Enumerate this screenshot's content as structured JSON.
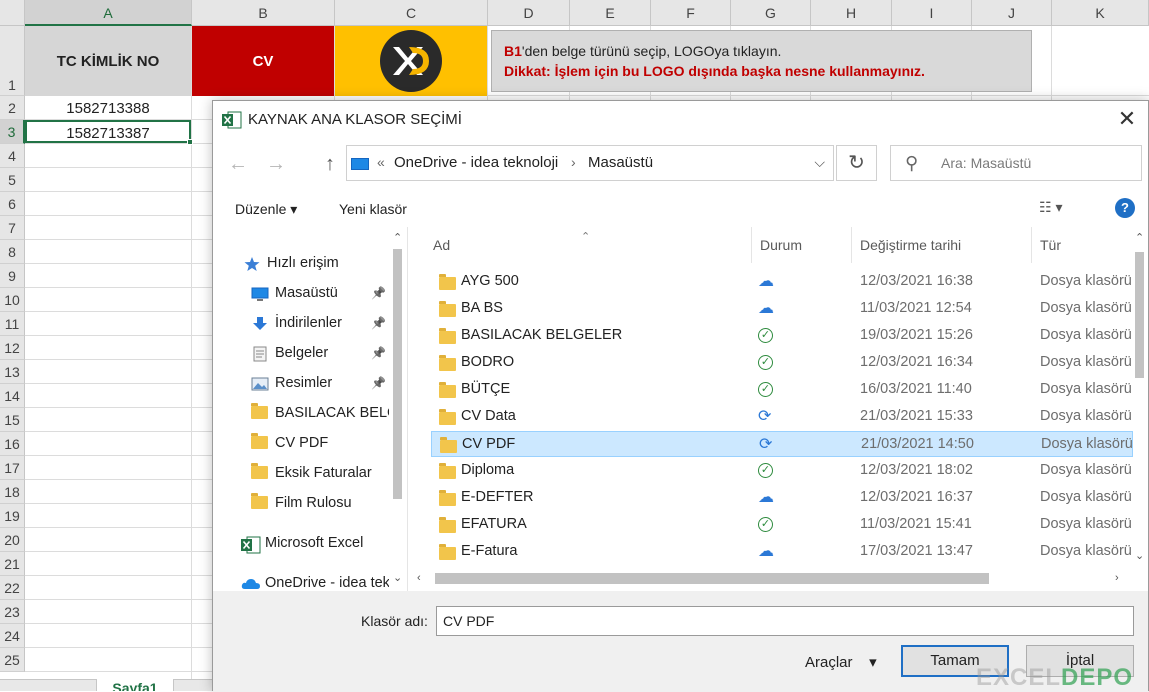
{
  "sheet": {
    "columns": [
      "A",
      "B",
      "C",
      "D",
      "E",
      "F",
      "G",
      "H",
      "I",
      "J",
      "K"
    ],
    "rows": [
      "1",
      "2",
      "3",
      "4",
      "5",
      "6",
      "7",
      "8",
      "9",
      "10",
      "11",
      "12",
      "13",
      "14",
      "15",
      "16",
      "17",
      "18",
      "19",
      "20",
      "21",
      "22",
      "23",
      "24",
      "25"
    ],
    "a1": "TC KİMLİK NO",
    "b1": "CV",
    "c1_logo": "XD",
    "info_line1_ref": "B1",
    "info_line1_rest": "'den belge türünü seçip, LOGOya tıklayın.",
    "info_line2": "Dikkat: İşlem için bu LOGO dışında başka nesne kullanmayınız.",
    "a2": "1582713388",
    "a3": "1582713387",
    "tab": "Sayfa1",
    "watermark_excel": "EXCEL",
    "watermark_depo": "DEPO"
  },
  "dialog": {
    "title": "KAYNAK ANA KLASOR SEÇİMİ",
    "address": {
      "prefix": "«",
      "part1": "OneDrive - idea teknoloji",
      "part2": "Masaüstü"
    },
    "search_placeholder": "Ara: Masaüstü",
    "toolbar": {
      "organize": "Düzenle ▾",
      "new_folder": "Yeni klasör",
      "help": "?"
    },
    "nav": [
      {
        "label": "Hızlı erişim",
        "icon": "star-icon"
      },
      {
        "label": "Masaüstü",
        "icon": "desktop-icon",
        "pinned": true
      },
      {
        "label": "İndirilenler",
        "icon": "download-icon",
        "pinned": true
      },
      {
        "label": "Belgeler",
        "icon": "documents-icon",
        "pinned": true
      },
      {
        "label": "Resimler",
        "icon": "pictures-icon",
        "pinned": true
      },
      {
        "label": "BASILACAK BELGELER",
        "icon": "folder-icon"
      },
      {
        "label": "CV PDF",
        "icon": "folder-icon"
      },
      {
        "label": "Eksik Faturalar",
        "icon": "folder-icon"
      },
      {
        "label": "Film Rulosu",
        "icon": "folder-icon"
      },
      {
        "label": "Microsoft Excel",
        "icon": "excel-icon"
      },
      {
        "label": "OneDrive - idea teknoloji",
        "icon": "onedrive-icon"
      }
    ],
    "columns": {
      "name": "Ad",
      "status": "Durum",
      "modified": "Değiştirme tarihi",
      "type": "Tür"
    },
    "files": [
      {
        "name": "AYG 500",
        "status": "cloud",
        "date": "12/03/2021 16:38",
        "type": "Dosya klasörü"
      },
      {
        "name": "BA BS",
        "status": "cloud",
        "date": "11/03/2021 12:54",
        "type": "Dosya klasörü"
      },
      {
        "name": "BASILACAK BELGELER",
        "status": "ok",
        "date": "19/03/2021 15:26",
        "type": "Dosya klasörü"
      },
      {
        "name": "BODRO",
        "status": "ok",
        "date": "12/03/2021 16:34",
        "type": "Dosya klasörü"
      },
      {
        "name": "BÜTÇE",
        "status": "ok",
        "date": "16/03/2021 11:40",
        "type": "Dosya klasörü"
      },
      {
        "name": "CV Data",
        "status": "sync",
        "date": "21/03/2021 15:33",
        "type": "Dosya klasörü"
      },
      {
        "name": "CV PDF",
        "status": "sync",
        "date": "21/03/2021 14:50",
        "type": "Dosya klasörü",
        "selected": true
      },
      {
        "name": "Diploma",
        "status": "ok",
        "date": "12/03/2021 18:02",
        "type": "Dosya klasörü"
      },
      {
        "name": "E-DEFTER",
        "status": "cloud",
        "date": "12/03/2021 16:37",
        "type": "Dosya klasörü"
      },
      {
        "name": "EFATURA",
        "status": "ok",
        "date": "11/03/2021 15:41",
        "type": "Dosya klasörü"
      },
      {
        "name": "E-Fatura",
        "status": "cloud",
        "date": "17/03/2021 13:47",
        "type": "Dosya klasörü"
      }
    ],
    "folder_label": "Klasör adı:",
    "folder_value": "CV PDF",
    "tools": "Araçlar",
    "ok": "Tamam",
    "cancel": "İptal"
  },
  "colors": {
    "excel_green": "#217346",
    "red": "#c00000",
    "gold": "#ffc000",
    "selection": "#cce8ff"
  }
}
